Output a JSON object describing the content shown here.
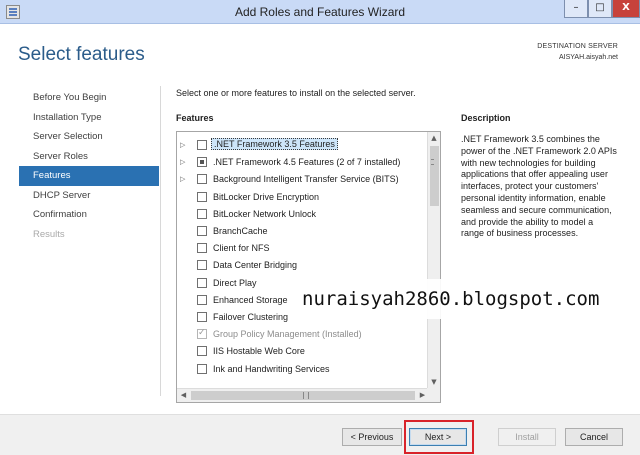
{
  "window": {
    "title": "Add Roles and Features Wizard",
    "controls": {
      "minimize": "–",
      "maximize": "□",
      "close": "X"
    }
  },
  "header": {
    "title": "Select features",
    "destination_label": "DESTINATION SERVER",
    "destination_server": "AISYAH.aisyah.net"
  },
  "nav": {
    "items": [
      {
        "label": "Before You Begin",
        "state": "normal"
      },
      {
        "label": "Installation Type",
        "state": "normal"
      },
      {
        "label": "Server Selection",
        "state": "normal"
      },
      {
        "label": "Server Roles",
        "state": "normal"
      },
      {
        "label": "Features",
        "state": "active"
      },
      {
        "label": "DHCP Server",
        "state": "normal"
      },
      {
        "label": "Confirmation",
        "state": "normal"
      },
      {
        "label": "Results",
        "state": "disabled"
      }
    ]
  },
  "main": {
    "instruction": "Select one or more features to install on the selected server.",
    "features_heading": "Features",
    "description_heading": "Description",
    "description_text": ".NET Framework 3.5 combines the power of the .NET Framework 2.0 APIs with new technologies for building applications that offer appealing user interfaces, protect your customers' personal identity information, enable seamless and secure communication, and provide the ability to model a range of business processes.",
    "features": [
      {
        "label": ".NET Framework 3.5 Features",
        "expandable": true,
        "check": "unchecked",
        "selected": true,
        "disabled": false
      },
      {
        "label": ".NET Framework 4.5 Features (2 of 7 installed)",
        "expandable": true,
        "check": "partial",
        "selected": false,
        "disabled": false
      },
      {
        "label": "Background Intelligent Transfer Service (BITS)",
        "expandable": true,
        "check": "unchecked",
        "selected": false,
        "disabled": false
      },
      {
        "label": "BitLocker Drive Encryption",
        "expandable": false,
        "check": "unchecked",
        "selected": false,
        "disabled": false
      },
      {
        "label": "BitLocker Network Unlock",
        "expandable": false,
        "check": "unchecked",
        "selected": false,
        "disabled": false
      },
      {
        "label": "BranchCache",
        "expandable": false,
        "check": "unchecked",
        "selected": false,
        "disabled": false
      },
      {
        "label": "Client for NFS",
        "expandable": false,
        "check": "unchecked",
        "selected": false,
        "disabled": false
      },
      {
        "label": "Data Center Bridging",
        "expandable": false,
        "check": "unchecked",
        "selected": false,
        "disabled": false
      },
      {
        "label": "Direct Play",
        "expandable": false,
        "check": "unchecked",
        "selected": false,
        "disabled": false
      },
      {
        "label": "Enhanced Storage",
        "expandable": false,
        "check": "unchecked",
        "selected": false,
        "disabled": false
      },
      {
        "label": "Failover Clustering",
        "expandable": false,
        "check": "unchecked",
        "selected": false,
        "disabled": false
      },
      {
        "label": "Group Policy Management (Installed)",
        "expandable": false,
        "check": "checked",
        "selected": false,
        "disabled": true
      },
      {
        "label": "IIS Hostable Web Core",
        "expandable": false,
        "check": "unchecked",
        "selected": false,
        "disabled": false
      },
      {
        "label": "Ink and Handwriting Services",
        "expandable": false,
        "check": "unchecked",
        "selected": false,
        "disabled": false
      }
    ]
  },
  "watermark": "nuraisyah2860.blogspot.com",
  "footer": {
    "previous": "< Previous",
    "next": "Next >",
    "install": "Install",
    "cancel": "Cancel"
  },
  "colors": {
    "titlebar": "#c9daf6",
    "nav_active": "#2a71b2",
    "header_title": "#2b5c8a",
    "highlight": "#d8232a"
  }
}
